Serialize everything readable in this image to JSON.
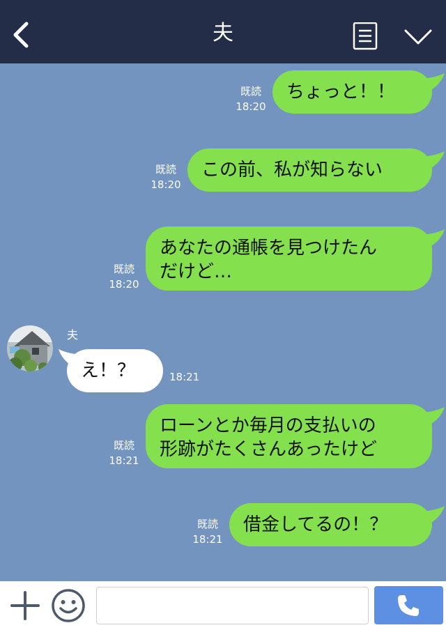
{
  "header": {
    "title": "夫",
    "back_icon": "chevron-left-icon",
    "menu_icon": "menu-document-icon",
    "dropdown_icon": "chevron-down-icon"
  },
  "chat": {
    "sender_name": "夫",
    "read_label": "既読",
    "messages": [
      {
        "from": "me",
        "text_lines": [
          "ちょっと！！"
        ],
        "time": "18:20",
        "read": true
      },
      {
        "from": "me",
        "text_lines": [
          "この前、私が知らない"
        ],
        "time": "18:20",
        "read": true
      },
      {
        "from": "me",
        "text_lines": [
          "あなたの通帳を見つけたん",
          "だけど…"
        ],
        "time": "18:20",
        "read": true
      },
      {
        "from": "them",
        "text_lines": [
          "え！？"
        ],
        "time": "18:21",
        "read": false
      },
      {
        "from": "me",
        "text_lines": [
          "ローンとか毎月の支払いの",
          "形跡がたくさんあったけど"
        ],
        "time": "18:21",
        "read": true
      },
      {
        "from": "me",
        "text_lines": [
          "借金してるの！？"
        ],
        "time": "18:21",
        "read": true
      }
    ]
  },
  "footer": {
    "input_value": "",
    "plus_icon": "plus-icon",
    "emoji_icon": "smiley-icon",
    "call_icon": "phone-icon"
  },
  "colors": {
    "header_bg": "#242d48",
    "chat_bg": "#7494c0",
    "my_bubble": "#84e04c",
    "their_bubble": "#ffffff",
    "call_button": "#5d8fe2"
  }
}
